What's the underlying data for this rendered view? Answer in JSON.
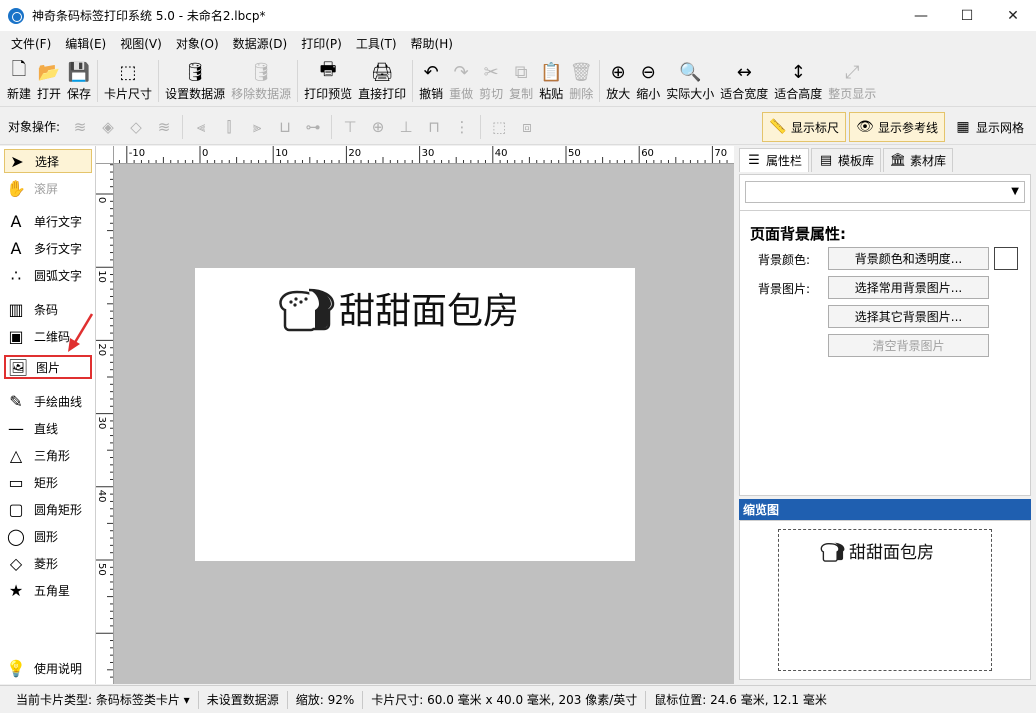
{
  "window": {
    "title": "神奇条码标签打印系统 5.0 - 未命名2.lbcp*",
    "buttons": {
      "minimize": "—",
      "maximize": "☐",
      "close": "✕"
    }
  },
  "menu": [
    "文件(F)",
    "编辑(E)",
    "视图(V)",
    "对象(O)",
    "数据源(D)",
    "打印(P)",
    "工具(T)",
    "帮助(H)"
  ],
  "toolbar": [
    {
      "label": "新建",
      "icon": "new-file-icon",
      "glyph": "🗋",
      "enabled": true
    },
    {
      "label": "打开",
      "icon": "open-icon",
      "glyph": "📂",
      "enabled": true
    },
    {
      "label": "保存",
      "icon": "save-icon",
      "glyph": "💾",
      "enabled": true
    },
    {
      "label": "卡片尺寸",
      "icon": "card-size-icon",
      "glyph": "⬚",
      "enabled": true
    },
    {
      "label": "设置数据源",
      "icon": "database-icon",
      "glyph": "🛢",
      "enabled": true
    },
    {
      "label": "移除数据源",
      "icon": "remove-database-icon",
      "glyph": "🛢",
      "enabled": false
    },
    {
      "label": "打印预览",
      "icon": "print-preview-icon",
      "glyph": "🖶",
      "enabled": true
    },
    {
      "label": "直接打印",
      "icon": "print-icon",
      "glyph": "🖨",
      "enabled": true
    },
    {
      "label": "撤销",
      "icon": "undo-icon",
      "glyph": "↶",
      "enabled": true
    },
    {
      "label": "重做",
      "icon": "redo-icon",
      "glyph": "↷",
      "enabled": false
    },
    {
      "label": "剪切",
      "icon": "cut-icon",
      "glyph": "✂",
      "enabled": false
    },
    {
      "label": "复制",
      "icon": "copy-icon",
      "glyph": "⧉",
      "enabled": false
    },
    {
      "label": "粘贴",
      "icon": "paste-icon",
      "glyph": "📋",
      "enabled": true
    },
    {
      "label": "删除",
      "icon": "delete-icon",
      "glyph": "🗑",
      "enabled": false
    },
    {
      "label": "放大",
      "icon": "zoom-in-icon",
      "glyph": "⊕",
      "enabled": true
    },
    {
      "label": "缩小",
      "icon": "zoom-out-icon",
      "glyph": "⊖",
      "enabled": true
    },
    {
      "label": "实际大小",
      "icon": "actual-size-icon",
      "glyph": "🔍",
      "enabled": true
    },
    {
      "label": "适合宽度",
      "icon": "fit-width-icon",
      "glyph": "↔",
      "enabled": true
    },
    {
      "label": "适合高度",
      "icon": "fit-height-icon",
      "glyph": "↕",
      "enabled": true
    },
    {
      "label": "整页显示",
      "icon": "fit-page-icon",
      "glyph": "⤢",
      "enabled": false
    }
  ],
  "objbar": {
    "label": "对象操作:",
    "toggles": [
      {
        "label": "显示标尺",
        "icon": "ruler-icon",
        "glyph": "📏",
        "active": true
      },
      {
        "label": "显示参考线",
        "icon": "eye-icon",
        "glyph": "👁",
        "active": true
      },
      {
        "label": "显示网格",
        "icon": "grid-icon",
        "glyph": "▦",
        "active": false
      }
    ]
  },
  "tools": [
    {
      "label": "选择",
      "icon": "pointer-icon",
      "glyph": "➤",
      "state": "selected"
    },
    {
      "label": "滚屏",
      "icon": "hand-icon",
      "glyph": "✋",
      "state": "disabled"
    },
    {
      "label": "单行文字",
      "icon": "single-line-text-icon",
      "glyph": "A",
      "state": ""
    },
    {
      "label": "多行文字",
      "icon": "multi-line-text-icon",
      "glyph": "A",
      "state": ""
    },
    {
      "label": "圆弧文字",
      "icon": "arc-text-icon",
      "glyph": "∴",
      "state": ""
    },
    {
      "label": "条码",
      "icon": "barcode-icon",
      "glyph": "▥",
      "state": ""
    },
    {
      "label": "二维码",
      "icon": "qrcode-icon",
      "glyph": "▣",
      "state": ""
    },
    {
      "label": "图片",
      "icon": "image-icon",
      "glyph": "🖼",
      "state": "highlight"
    },
    {
      "label": "手绘曲线",
      "icon": "pen-icon",
      "glyph": "✎",
      "state": ""
    },
    {
      "label": "直线",
      "icon": "line-icon",
      "glyph": "—",
      "state": ""
    },
    {
      "label": "三角形",
      "icon": "triangle-icon",
      "glyph": "△",
      "state": ""
    },
    {
      "label": "矩形",
      "icon": "rectangle-icon",
      "glyph": "▭",
      "state": ""
    },
    {
      "label": "圆角矩形",
      "icon": "rounded-rectangle-icon",
      "glyph": "▢",
      "state": ""
    },
    {
      "label": "圆形",
      "icon": "ellipse-icon",
      "glyph": "◯",
      "state": ""
    },
    {
      "label": "菱形",
      "icon": "diamond-icon",
      "glyph": "◇",
      "state": ""
    },
    {
      "label": "五角星",
      "icon": "star-icon",
      "glyph": "★",
      "state": ""
    },
    {
      "label": "使用说明",
      "icon": "lightbulb-icon",
      "glyph": "💡",
      "state": ""
    }
  ],
  "ruler": {
    "h_labels": [
      "-10",
      "0",
      "10",
      "20",
      "30",
      "40",
      "50",
      "60",
      "70"
    ],
    "v_labels": [
      "0",
      "10",
      "20",
      "30",
      "40",
      "50"
    ]
  },
  "canvas": {
    "card_text": "甜甜面包房",
    "bread_icon": "bread-icon"
  },
  "right": {
    "tabs": [
      {
        "label": "属性栏",
        "icon": "list-icon",
        "glyph": "☰",
        "active": true
      },
      {
        "label": "模板库",
        "icon": "template-icon",
        "glyph": "▤",
        "active": false
      },
      {
        "label": "素材库",
        "icon": "bank-icon",
        "glyph": "🏛",
        "active": false
      }
    ],
    "combo_value": "",
    "section_title": "页面背景属性:",
    "bg_color_label": "背景颜色:",
    "bg_image_label": "背景图片:",
    "btn_color": "背景颜色和透明度...",
    "btn_common": "选择常用背景图片...",
    "btn_other": "选择其它背景图片...",
    "btn_clear": "清空背景图片",
    "preview_title": "缩览图",
    "swatch_color": "#ffffff"
  },
  "status": [
    "当前卡片类型:  条码标签类卡片 ▾",
    "未设置数据源",
    "缩放:  92%",
    "卡片尺寸:  60.0 毫米 x 40.0 毫米, 203 像素/英寸",
    "鼠标位置:  24.6 毫米,  12.1 毫米"
  ],
  "colors": {
    "accent": "#1f5fb0",
    "selected_bg": "#fdf3d6",
    "highlight_border": "#e03030",
    "canvas_bg": "#c0c0c0"
  }
}
